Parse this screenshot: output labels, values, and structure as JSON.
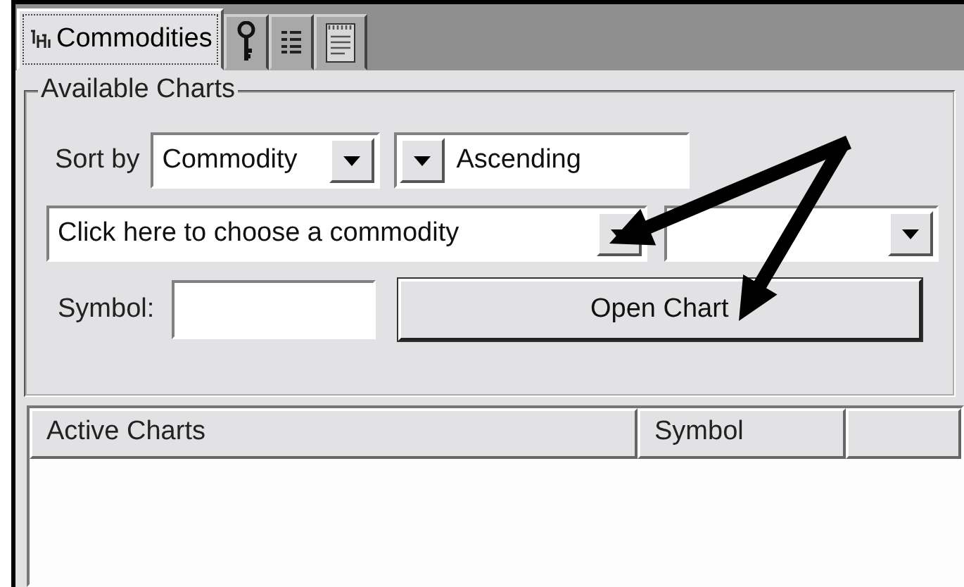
{
  "tabs": [
    {
      "kind": "chart",
      "label": "Commodities",
      "selected": true
    },
    {
      "kind": "key",
      "selected": false
    },
    {
      "kind": "list",
      "selected": false
    },
    {
      "kind": "notepad",
      "selected": false
    }
  ],
  "available_charts": {
    "title": "Available Charts",
    "sort_label": "Sort by",
    "sort_field": {
      "value": "Commodity"
    },
    "sort_order": {
      "value": "Ascending"
    },
    "commodity": {
      "placeholder": "Click here to choose a commodity"
    },
    "symbol_label": "Symbol:",
    "open_button": "Open Chart"
  },
  "active_charts": {
    "columns": [
      "Active Charts",
      "Symbol"
    ]
  }
}
